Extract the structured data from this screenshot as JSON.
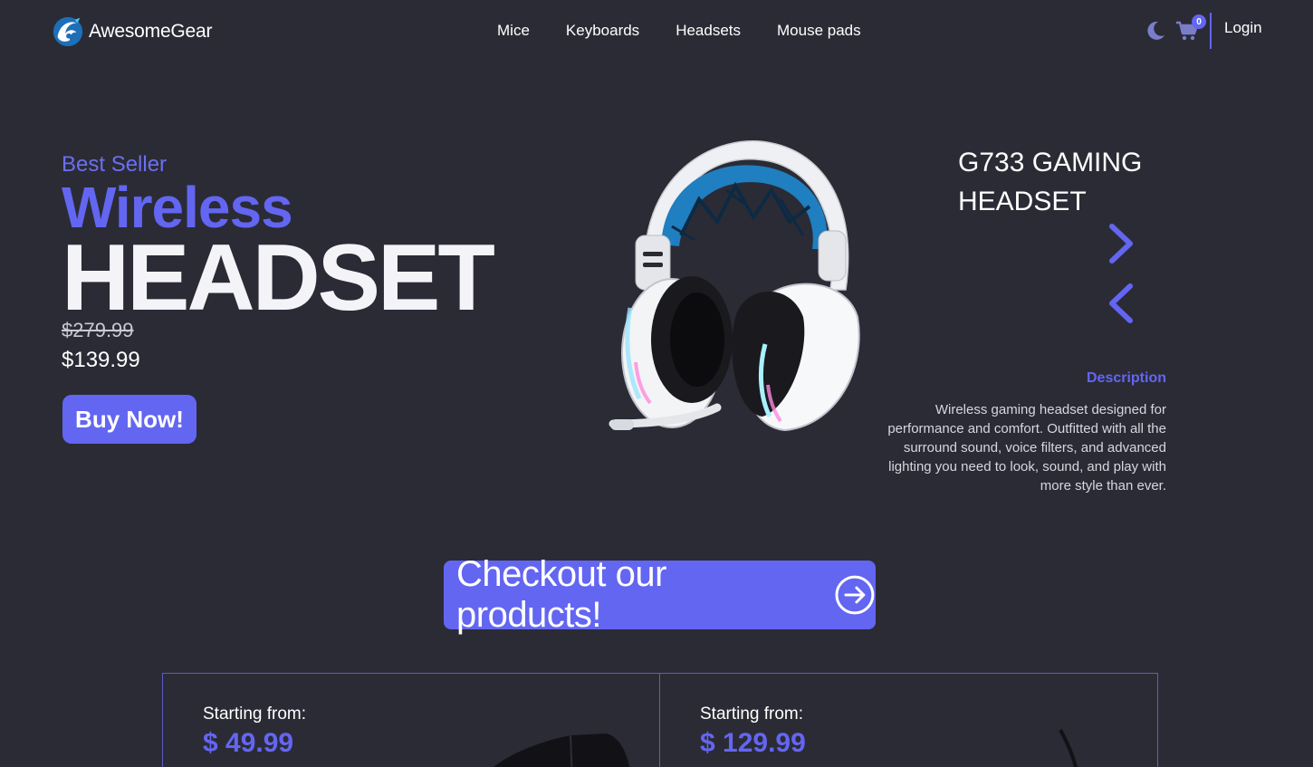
{
  "nav": {
    "brand": "AwesomeGear",
    "links": [
      "Mice",
      "Keyboards",
      "Headsets",
      "Mouse pads"
    ],
    "cart_count": "0",
    "login": "Login",
    "icons": {
      "logo": "awesomegear-logo",
      "theme": "moon-icon",
      "cart": "cart-icon"
    }
  },
  "hero": {
    "eyebrow": "Best Seller",
    "title_line1": "Wireless",
    "title_line2": "HEADSET",
    "old_price": "$279.99",
    "new_price": "$139.99",
    "buy_button": "Buy Now!"
  },
  "product": {
    "name": "G733 GAMING HEADSET",
    "description_label": "Description",
    "description": "Wireless gaming headset designed for performance and comfort. Outfitted with all the surround sound, voice filters, and advanced lighting you need to look, sound, and play with more style than ever."
  },
  "cta": {
    "label": "Checkout our products!",
    "icon": "arrow-right-circle-icon"
  },
  "cards": [
    {
      "label": "Starting from:",
      "price": "$ 49.99"
    },
    {
      "label": "Starting from:",
      "price": "$ 129.99"
    }
  ],
  "colors": {
    "background": "#2b2b36",
    "accent": "#6366f1",
    "text": "#ffffff"
  }
}
